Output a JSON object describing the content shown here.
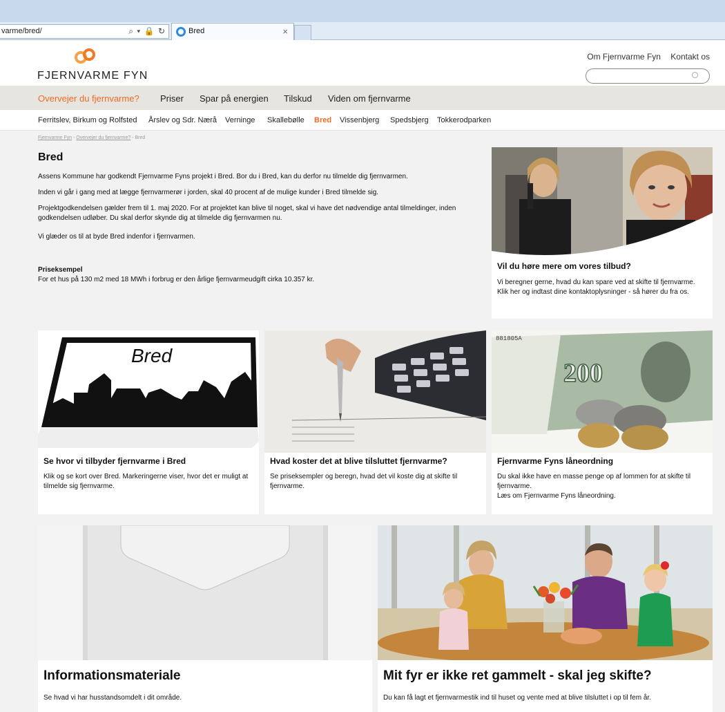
{
  "browser": {
    "address": "varme/bred/",
    "address_tools": "⌕ ▾ 🔒 ↻",
    "tab_title": "Bred",
    "tab_close": "×"
  },
  "header": {
    "logo_text": "FJERNVARME FYN",
    "top_links": [
      "Om Fjernvarme Fyn",
      "Kontakt os"
    ],
    "search_placeholder": ""
  },
  "main_nav": [
    "Overvejer du fjernvarme?",
    "Priser",
    "Spar på energien",
    "Tilskud",
    "Viden om fjernvarme"
  ],
  "sub_nav": [
    "Ferritslev, Birkum og Rolfsted",
    "Årslev og Sdr. Nærå",
    "Verninge",
    "Skallebølle",
    "Bred",
    "Vissenbjerg",
    "Spedsbjerg",
    "Tokkerodparken"
  ],
  "breadcrumb": {
    "items": [
      "Fjernvarme Fyn",
      "Overvejer du fjernvarme?",
      "Bred"
    ],
    "separator": " - "
  },
  "article": {
    "title": "Bred",
    "paragraphs": [
      "Assens Kommune har godkendt Fjernvarme Fyns projekt i Bred. Bor du i Bred, kan du derfor nu tilmelde dig fjernvarmen.",
      "Inden vi går i gang med at lægge fjernvarmerør i jorden, skal 40 procent af de mulige kunder i Bred tilmelde sig.",
      "Projektgodkendelsen gælder frem til 1. maj 2020. For at projektet kan blive til noget, skal vi have det nødvendige antal tilmeldinger, inden godkendelsen udløber. Du skal derfor skynde dig at tilmelde dig fjernvarmen nu.",
      "Vi glæder os til at byde Bred indenfor i fjernvarmen."
    ],
    "price_title": "Priseksempel",
    "price_text": "For et hus på 130 m2 med 18 MWh i forbrug er den årlige fjernvarmeudgift cirka 10.357 kr."
  },
  "offer_card": {
    "title": "Vil du høre mere om vores tilbud?",
    "text": "Vi beregner gerne, hvad du kan spare ved at skifte til fjernvarme. Klik her og indtast dine kontaktoplysninger - så hører du fra os."
  },
  "cards": [
    {
      "title": "Se hvor vi tilbyder fjernvarme i Bred",
      "text": "Klik og se kort over Bred. Markeringerne viser, hvor det er muligt at tilmelde sig fjernvarme.",
      "sign_text": "Bred"
    },
    {
      "title": "Hvad koster det at blive tilsluttet fjernvarme?",
      "text": "Se priseksempler og beregn, hvad det vil koste dig at skifte til fjernvarme."
    },
    {
      "title": "Fjernvarme Fyns låneordning",
      "text": "Du skal ikke have en masse penge op af lommen for at skifte til fjernvarme.",
      "text2": "Læs om Fjernvarme Fyns låneordning.",
      "banknote": "200",
      "banknote_serial": "881805A"
    }
  ],
  "big_cards": [
    {
      "title": "Informationsmateriale",
      "text": "Se hvad vi har husstandsomdelt i dit område."
    },
    {
      "title": "Mit fyr er ikke ret gammelt - skal jeg skifte?",
      "text": "Du kan få lagt et fjernvarmestik ind til huset og vente med at blive tilsluttet i op til fem år."
    }
  ],
  "colors": {
    "accent": "#ef6b24",
    "nav_bg": "#e7e5e0",
    "page_bg": "#f2f2f2"
  }
}
